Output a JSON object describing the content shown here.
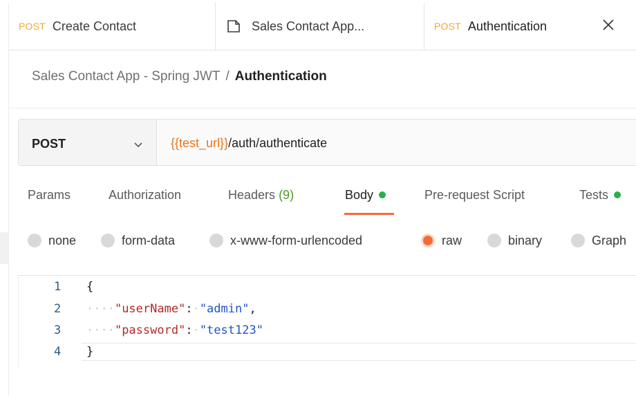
{
  "tabs": [
    {
      "method": "POST",
      "label": "Create Contact"
    },
    {
      "label": "Sales Contact App..."
    },
    {
      "method": "POST",
      "label": "Authentication"
    }
  ],
  "breadcrumb": {
    "parent": "Sales Contact App - Spring JWT",
    "separator": "/",
    "current": "Authentication"
  },
  "request": {
    "method": "POST",
    "url_variable": "{{test_url}}",
    "url_path": "/auth/authenticate"
  },
  "request_tabs": {
    "params": "Params",
    "authorization": "Authorization",
    "headers": "Headers",
    "headers_count": "(9)",
    "body": "Body",
    "pre_request": "Pre-request Script",
    "tests": "Tests"
  },
  "body_types": {
    "none": "none",
    "form_data": "form-data",
    "urlencoded": "x-www-form-urlencoded",
    "raw": "raw",
    "binary": "binary",
    "graphql": "Graph"
  },
  "body_type_selected": "raw",
  "editor": {
    "line_numbers": [
      "1",
      "2",
      "3",
      "4"
    ],
    "open_brace": "{",
    "close_brace": "}",
    "field1_key": "\"userName\"",
    "field1_value": "\"admin\"",
    "field2_key": "\"password\"",
    "field2_value": "\"test123\""
  },
  "colors": {
    "accent": "#f26b3a",
    "post_tag": "#f0a733",
    "url_variable": "#e8761a",
    "status_dot": "#26b14a"
  }
}
